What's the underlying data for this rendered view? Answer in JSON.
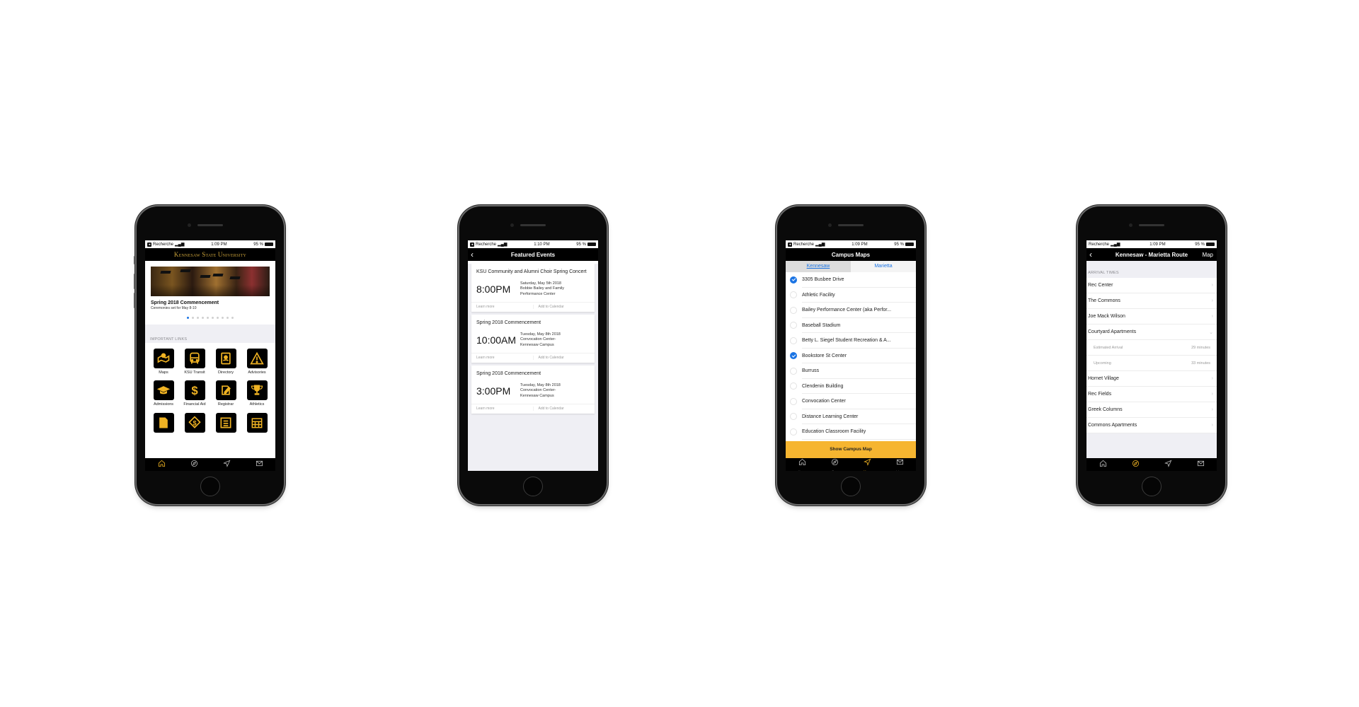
{
  "phones": [
    {
      "status": {
        "carrier": "Recherche",
        "time": "1:09 PM",
        "battery": "95 %"
      },
      "header": {
        "title": "Kennesaw State University"
      },
      "carousel": {
        "title": "Spring 2018 Commencement",
        "subtitle": "Ceremonies set for May 8-10",
        "page_count": 10,
        "active_page": 1
      },
      "section_header": "IMPORTANT LINKS",
      "links": [
        {
          "label": "Maps",
          "icon": "map-pin-icon"
        },
        {
          "label": "KSU Transit",
          "icon": "bus-icon"
        },
        {
          "label": "Directory",
          "icon": "address-book-icon"
        },
        {
          "label": "Advisories",
          "icon": "warning-icon"
        },
        {
          "label": "Admissions",
          "icon": "graduation-cap-icon"
        },
        {
          "label": "Financial Aid",
          "icon": "dollar-icon"
        },
        {
          "label": "Registrar",
          "icon": "edit-note-icon"
        },
        {
          "label": "Athletics",
          "icon": "trophy-icon"
        },
        {
          "label": "",
          "icon": "book-icon"
        },
        {
          "label": "",
          "icon": "dollar-tag-icon"
        },
        {
          "label": "",
          "icon": "newspaper-icon"
        },
        {
          "label": "",
          "icon": "calendar-icon"
        }
      ],
      "tabbar": [
        {
          "label": "",
          "icon": "home-icon",
          "active": true
        },
        {
          "label": "",
          "icon": "compass-icon",
          "active": false
        },
        {
          "label": "",
          "icon": "location-arrow-icon",
          "active": false
        },
        {
          "label": "",
          "icon": "mail-icon",
          "active": false
        }
      ]
    },
    {
      "status": {
        "carrier": "Recherche",
        "time": "1:10 PM",
        "battery": "95 %"
      },
      "navbar": {
        "title": "Featured Events"
      },
      "events": [
        {
          "title": "KSU Community and Alumni Choir Spring Concert",
          "time": "8:00PM",
          "date": "Saturday, May 5th 2018",
          "location_line1": "Bobbie Bailey and Family",
          "location_line2": "Performance Center",
          "learn_more": "Learn more",
          "add_to_calendar": "Add to Calendar"
        },
        {
          "title": "Spring 2018 Commencement",
          "time": "10:00AM",
          "date": "Tuesday, May 8th 2018",
          "location_line1": "Convocation Center-",
          "location_line2": "Kennesaw Campus",
          "learn_more": "Learn more",
          "add_to_calendar": "Add to Calendar"
        },
        {
          "title": "Spring 2018 Commencement",
          "time": "3:00PM",
          "date": "Tuesday, May 8th 2018",
          "location_line1": "Convocation Center-",
          "location_line2": "Kennesaw Campus",
          "learn_more": "Learn more",
          "add_to_calendar": "Add to Calendar"
        }
      ]
    },
    {
      "status": {
        "carrier": "Recherche",
        "time": "1:09 PM",
        "battery": "95 %"
      },
      "navbar": {
        "title": "Campus Maps"
      },
      "segments": [
        {
          "label": "Kennesaw",
          "selected": true
        },
        {
          "label": "Marietta",
          "selected": false
        }
      ],
      "locations": [
        {
          "name": "3305 Busbee Drive",
          "checked": true
        },
        {
          "name": "Athletic Facility",
          "checked": false
        },
        {
          "name": "Bailey Performance Center (aka Perfor...",
          "checked": false
        },
        {
          "name": "Baseball Stadium",
          "checked": false
        },
        {
          "name": "Betty L. Siegel Student Recreation & A...",
          "checked": false
        },
        {
          "name": "Bookstore St Center",
          "checked": true
        },
        {
          "name": "Burruss",
          "checked": false
        },
        {
          "name": "Clendenin Building",
          "checked": false
        },
        {
          "name": "Convocation Center",
          "checked": false
        },
        {
          "name": "Distance Learning Center",
          "checked": false
        },
        {
          "name": "Education Classroom Facility",
          "checked": false
        }
      ],
      "action_button": "Show Campus Map",
      "accent_color": "#f6b530",
      "tabbar": [
        {
          "label": "Home",
          "icon": "home-icon",
          "active": false
        },
        {
          "label": "Bus",
          "icon": "compass-icon",
          "active": false
        },
        {
          "label": "Maps",
          "icon": "location-arrow-icon",
          "active": true
        },
        {
          "label": "Inbox",
          "icon": "mail-icon",
          "active": false
        }
      ]
    },
    {
      "status": {
        "carrier": "Recherche",
        "time": "1:09 PM",
        "battery": "95 %"
      },
      "navbar": {
        "title": "Kennesaw - Marietta Route",
        "right_link": "Map"
      },
      "section_header": "ARRIVAL TIMES",
      "stops": [
        {
          "name": "Rec Center",
          "expanded": false
        },
        {
          "name": "The Commons",
          "expanded": false
        },
        {
          "name": "Joe Mack Wilson",
          "expanded": false
        },
        {
          "name": "Courtyard Apartments",
          "expanded": true,
          "details": [
            {
              "label": "Estimated Arrival",
              "value": "29 minutes"
            },
            {
              "label": "Upcoming",
              "value": "33 minutes"
            }
          ]
        },
        {
          "name": "Hornet Village",
          "expanded": false
        },
        {
          "name": "Rec Fields",
          "expanded": false
        },
        {
          "name": "Greek Columns",
          "expanded": false
        },
        {
          "name": "Commons Apartments",
          "expanded": false
        }
      ],
      "tabbar": [
        {
          "label": "",
          "icon": "home-icon",
          "active": false
        },
        {
          "label": "",
          "icon": "compass-icon",
          "active": true
        },
        {
          "label": "",
          "icon": "location-arrow-icon",
          "active": false
        },
        {
          "label": "",
          "icon": "mail-icon",
          "active": false
        }
      ]
    }
  ],
  "colors": {
    "ksu_gold": "#f0b323",
    "ios_blue": "#1b74e4",
    "nav_black": "#000000"
  }
}
